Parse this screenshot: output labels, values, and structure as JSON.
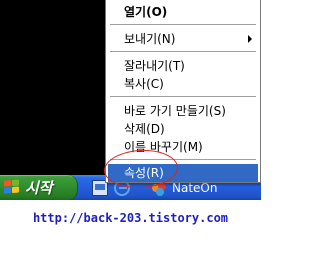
{
  "context_menu": {
    "items": [
      {
        "label": "열기(O)",
        "bold": true
      },
      {
        "label": "보내기(N)",
        "has_submenu": true
      },
      {
        "label": "잘라내기(T)"
      },
      {
        "label": "복사(C)"
      },
      {
        "label": "바로 가기 만들기(S)"
      },
      {
        "label": "삭제(D)"
      },
      {
        "label": "이름 바꾸기(M)"
      },
      {
        "label": "속성(R)",
        "highlighted": true
      }
    ],
    "highlight_color": "#316ac5"
  },
  "taskbar": {
    "start_label": "시작",
    "task_item_label": "NateOn",
    "quick_launch_icons": [
      "show-desktop-icon",
      "internet-explorer-icon"
    ]
  },
  "annotation": {
    "color": "#e02020",
    "target": "속성(R)"
  },
  "watermark": {
    "url": "http://back-203.tistory.com"
  },
  "colors": {
    "desktop": "#000000",
    "taskbar_blue": "#245edb",
    "start_green": "#2f8a2c",
    "url_text": "#1f1fc0"
  }
}
